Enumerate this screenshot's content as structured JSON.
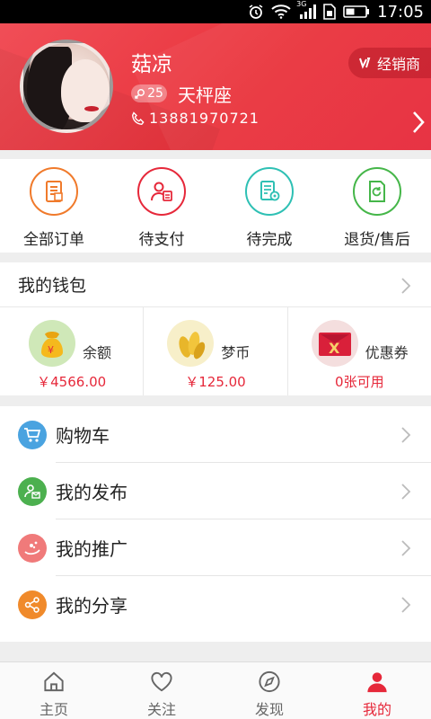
{
  "status_bar": {
    "time": "17:05",
    "network": "3G"
  },
  "profile": {
    "name": "菇凉",
    "age": "25",
    "constellation": "天枰座",
    "phone": "13881970721",
    "dealer_label": "经销商"
  },
  "orders": [
    {
      "label": "全部订单",
      "icon": "order-list-icon",
      "color": "#f07a2b"
    },
    {
      "label": "待支付",
      "icon": "wallet-user-icon",
      "color": "#e6283a"
    },
    {
      "label": "待完成",
      "icon": "doc-gear-icon",
      "color": "#2ec0b4"
    },
    {
      "label": "退货/售后",
      "icon": "return-icon",
      "color": "#45b649"
    }
  ],
  "wallet": {
    "title": "我的钱包",
    "items": [
      {
        "label": "余额",
        "value": "￥4566.00",
        "icon": "money-bag-icon"
      },
      {
        "label": "梦币",
        "value": "￥125.00",
        "icon": "coins-icon"
      },
      {
        "label": "优惠券",
        "value": "0张可用",
        "icon": "coupon-icon"
      }
    ]
  },
  "menu": [
    {
      "label": "购物车",
      "icon": "cart-icon",
      "color": "#4aa3e0"
    },
    {
      "label": "我的发布",
      "icon": "publish-icon",
      "color": "#4cb04f"
    },
    {
      "label": "我的推广",
      "icon": "promotion-icon",
      "color": "#f07a7a"
    },
    {
      "label": "我的分享",
      "icon": "share-icon",
      "color": "#f08a2b"
    }
  ],
  "nav": [
    {
      "label": "主页",
      "icon": "home-icon"
    },
    {
      "label": "关注",
      "icon": "heart-icon"
    },
    {
      "label": "发现",
      "icon": "compass-icon"
    },
    {
      "label": "我的",
      "icon": "user-icon",
      "active": true
    }
  ],
  "colors": {
    "accent": "#e6283a"
  }
}
